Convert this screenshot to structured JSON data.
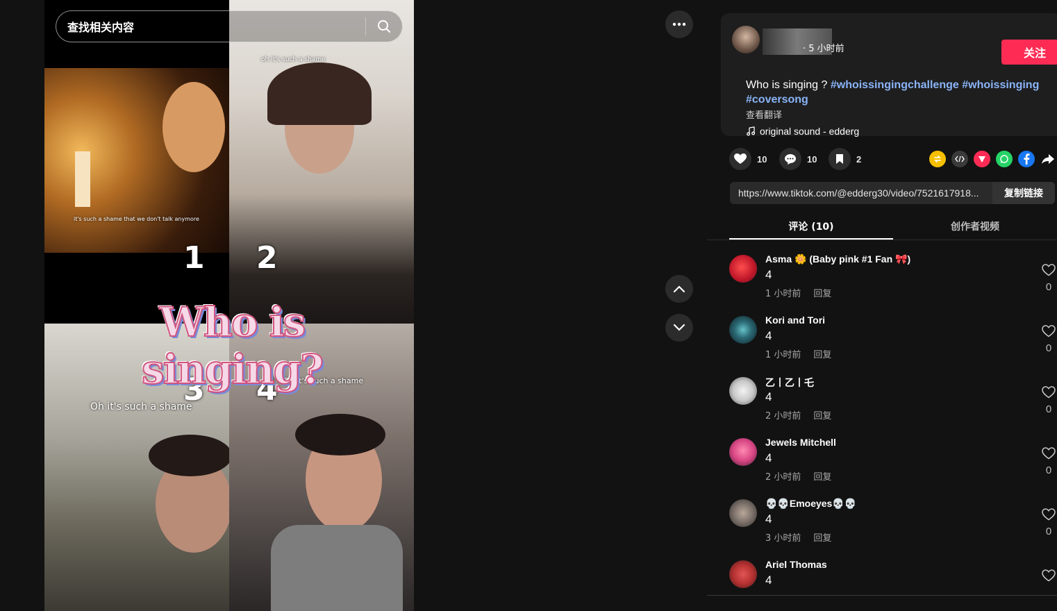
{
  "search": {
    "placeholder": "查找相关内容"
  },
  "video": {
    "caption_top_right": "oh it's such a shame",
    "caption_q1": "it's such a shame that we don't talk anymore",
    "caption_q3": "Oh it's such a shame",
    "caption_q4": "Oh it's such a shame",
    "numbers": [
      "1",
      "2",
      "3",
      "4"
    ],
    "overlay_title": "Who is singing?"
  },
  "post": {
    "time": "· 5 小时前",
    "follow_label": "关注",
    "description": "Who is singing ?",
    "hashtags": [
      "#whoissingingchallenge",
      "#whoissinging",
      "#coversong"
    ],
    "translate_label": "查看翻译",
    "music": "original sound - edderg"
  },
  "stats": {
    "likes": "10",
    "comments": "10",
    "saves": "2"
  },
  "share_icons": [
    "repost-icon",
    "embed-icon",
    "send-icon",
    "whatsapp-icon",
    "facebook-icon",
    "share-arrow-icon"
  ],
  "link": {
    "url": "https://www.tiktok.com/@edderg30/video/7521617918...",
    "copy_label": "复制链接"
  },
  "tabs": {
    "comments": "评论 (10)",
    "creator_videos": "创作者视频"
  },
  "comments": [
    {
      "name": "Asma 🌼 (Baby pink #1 Fan 🎀)",
      "text": "4",
      "time": "1 小时前",
      "reply": "回复",
      "likes": "0"
    },
    {
      "name": "Kori and Tori",
      "text": "4",
      "time": "1 小时前",
      "reply": "回复",
      "likes": "0"
    },
    {
      "name": "乙丨乙丨乇",
      "text": "4",
      "time": "2 小时前",
      "reply": "回复",
      "likes": "0"
    },
    {
      "name": "Jewels Mitchell",
      "text": "4",
      "time": "2 小时前",
      "reply": "回复",
      "likes": "0"
    },
    {
      "name": "💀💀Emoeyes💀💀",
      "text": "4",
      "time": "3 小时前",
      "reply": "回复",
      "likes": "0"
    },
    {
      "name": "Ariel Thomas",
      "text": "4",
      "time": "",
      "reply": "",
      "likes": ""
    }
  ],
  "colors": {
    "accent": "#fe2c55",
    "hashtag": "#8ab4f8",
    "background": "#121212"
  }
}
